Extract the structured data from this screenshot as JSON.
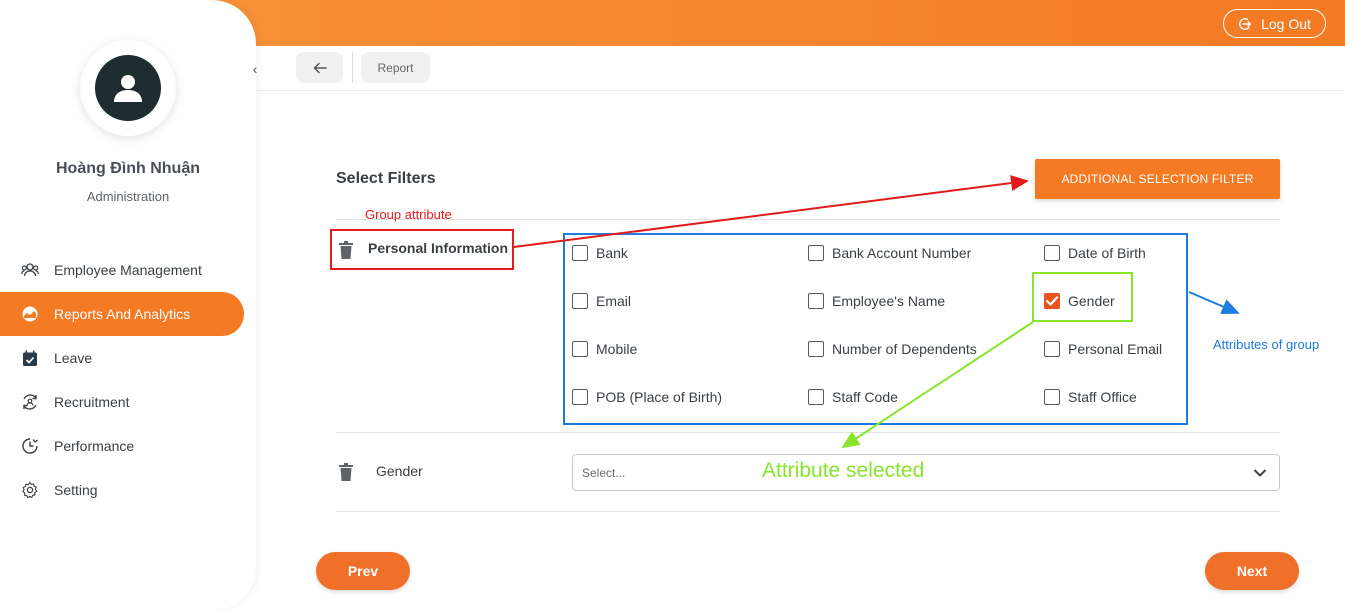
{
  "header": {
    "logout_label": "Log Out",
    "accent_color": "#f47a24"
  },
  "sidebar": {
    "user_name": "Hoàng Đình Nhuận",
    "user_role": "Administration",
    "items": [
      {
        "label": "Employee Management",
        "icon": "users-icon"
      },
      {
        "label": "Reports And Analytics",
        "icon": "chart-pie-icon",
        "active": true
      },
      {
        "label": "Leave",
        "icon": "calendar-check-icon"
      },
      {
        "label": "Recruitment",
        "icon": "recruit-cycle-icon"
      },
      {
        "label": "Performance",
        "icon": "clock-performance-icon"
      },
      {
        "label": "Setting",
        "icon": "gear-icon"
      }
    ]
  },
  "breadcrumb": {
    "items": [
      "Report"
    ]
  },
  "main": {
    "section_title": "Select Filters",
    "add_filter_label": "ADDITIONAL SELECTION FILTER",
    "group": {
      "name": "Personal Information",
      "attributes": [
        {
          "label": "Bank",
          "checked": false
        },
        {
          "label": "Bank Account Number",
          "checked": false
        },
        {
          "label": "Date of Birth",
          "checked": false
        },
        {
          "label": "Email",
          "checked": false
        },
        {
          "label": "Employee's Name",
          "checked": false
        },
        {
          "label": "Gender",
          "checked": true
        },
        {
          "label": "Mobile",
          "checked": false
        },
        {
          "label": "Number of Dependents",
          "checked": false
        },
        {
          "label": "Personal Email",
          "checked": false
        },
        {
          "label": "POB (Place of Birth)",
          "checked": false
        },
        {
          "label": "Staff Code",
          "checked": false
        },
        {
          "label": "Staff Office",
          "checked": false
        }
      ]
    },
    "filter_row": {
      "label": "Gender",
      "select_placeholder": "Select..."
    },
    "prev_label": "Prev",
    "next_label": "Next"
  },
  "annotations": {
    "group_attribute": "Group attribute",
    "attributes_of_group": "Attributes of group",
    "attribute_selected": "Attribute selected",
    "colors": {
      "red": "#e21b1b",
      "blue": "#1e7be0",
      "green": "#87e62a"
    }
  }
}
